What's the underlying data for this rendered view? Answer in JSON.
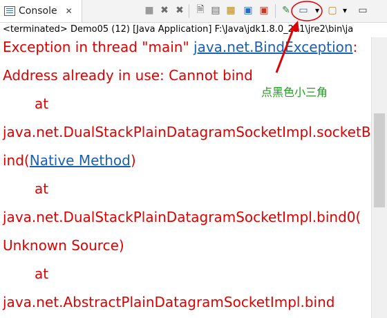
{
  "tab": {
    "label": "Console",
    "close": "✕"
  },
  "toolbar": [
    {
      "name": "terminate-icon",
      "glyph": "■"
    },
    {
      "name": "remove-launch-icon",
      "glyph": "✖"
    },
    {
      "name": "remove-all-icon",
      "glyph": "✖"
    },
    {
      "name": "clear-console-icon",
      "glyph": "🗎"
    },
    {
      "name": "scroll-lock-icon",
      "glyph": "▤"
    },
    {
      "name": "word-wrap-icon",
      "glyph": "▦"
    },
    {
      "name": "show-console-icon",
      "glyph": "▣"
    },
    {
      "name": "show-error-icon",
      "glyph": "▣"
    },
    {
      "name": "pin-console-icon",
      "glyph": "✎"
    },
    {
      "name": "display-console-icon",
      "glyph": "▭"
    },
    {
      "name": "display-console-dropdown-icon",
      "glyph": "▾"
    },
    {
      "name": "new-console-icon",
      "glyph": "▢"
    },
    {
      "name": "new-console-dropdown-icon",
      "glyph": "▾"
    },
    {
      "name": "minimize-icon",
      "glyph": "▭"
    }
  ],
  "status": "<terminated> Demo05 (12) [Java Application] F:\\Java\\jdk1.8.0_231\\jre2\\bin\\ja",
  "console": {
    "line1_prefix": "Exception in thread \"main\" ",
    "line1_link": "java.net.BindException",
    "line1_suffix": ":",
    "line2": "Address already in use: Cannot bind",
    "at": "at",
    "line4": "java.net.DualStackPlainDatagramSocketImpl.socketB",
    "line5_prefix": "ind(",
    "line5_link": "Native Method",
    "line5_suffix": ")",
    "line7": "java.net.DualStackPlainDatagramSocketImpl.bind0(",
    "line8": "Unknown Source)",
    "line10": "java.net.AbstractPlainDatagramSocketImpl.bind"
  },
  "annotation": {
    "text": "点黑色小三角",
    "color": "#19a119",
    "arrow_color": "#e00000"
  }
}
